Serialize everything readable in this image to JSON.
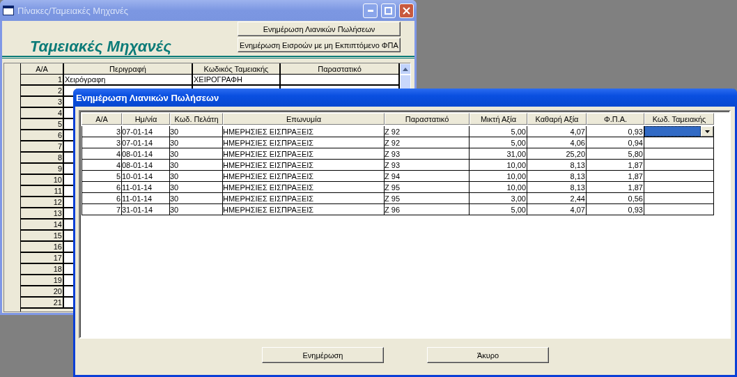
{
  "back_window": {
    "title": "Πίνακες/Ταμειακές Μηχανές",
    "buttons": [
      "Ενημέρωση Λιανικών Πωλήσεων",
      "Ενημέρωση Εισροών με μη Εκπιπτόμενο ΦΠΑ"
    ],
    "heading": "Ταμειακές Μηχανές",
    "table": {
      "columns": [
        "Α/Α",
        "Περιγραφή",
        "Κωδικός Ταμειακής",
        "Παραστατικό"
      ],
      "rows": [
        {
          "aa": "1",
          "description": "Χειρόγραφη",
          "code": "ΧΕΙΡΟΓΡΑΦΗ"
        },
        {
          "aa": "2"
        },
        {
          "aa": "3"
        },
        {
          "aa": "4"
        },
        {
          "aa": "5"
        },
        {
          "aa": "6"
        },
        {
          "aa": "7"
        },
        {
          "aa": "8"
        },
        {
          "aa": "9"
        },
        {
          "aa": "10"
        },
        {
          "aa": "11"
        },
        {
          "aa": "12"
        },
        {
          "aa": "13"
        },
        {
          "aa": "14"
        },
        {
          "aa": "15"
        },
        {
          "aa": "16"
        },
        {
          "aa": "17"
        },
        {
          "aa": "18"
        },
        {
          "aa": "19"
        },
        {
          "aa": "20"
        },
        {
          "aa": "21"
        }
      ]
    }
  },
  "dialog": {
    "title": "Ενημέρωση Λιανικών Πωλήσεων",
    "table": {
      "columns": [
        "Α/Α",
        "Ημ/νία",
        "Κωδ. Πελάτη",
        "Επωνυμία",
        "Παραστατικό",
        "Μικτή Αξία",
        "Καθαρή Αξία",
        "Φ.Π.Α.",
        "Κωδ. Ταμειακής"
      ],
      "rows": [
        {
          "cells": [
            "3",
            "07-01-14",
            "30",
            "ΗΜΕΡΗΣΙΕΣ ΕΙΣΠΡΑΞΕΙΣ",
            "Ζ 92",
            "5,00",
            "4,07",
            "0,93"
          ],
          "selected": true
        },
        {
          "cells": [
            "3",
            "07-01-14",
            "30",
            "ΗΜΕΡΗΣΙΕΣ ΕΙΣΠΡΑΞΕΙΣ",
            "Ζ 92",
            "5,00",
            "4,06",
            "0,94"
          ],
          "selected": false
        },
        {
          "cells": [
            "4",
            "08-01-14",
            "30",
            "ΗΜΕΡΗΣΙΕΣ ΕΙΣΠΡΑΞΕΙΣ",
            "Ζ 93",
            "31,00",
            "25,20",
            "5,80"
          ],
          "selected": false
        },
        {
          "cells": [
            "4",
            "08-01-14",
            "30",
            "ΗΜΕΡΗΣΙΕΣ ΕΙΣΠΡΑΞΕΙΣ",
            "Ζ 93",
            "10,00",
            "8,13",
            "1,87"
          ],
          "selected": false
        },
        {
          "cells": [
            "5",
            "10-01-14",
            "30",
            "ΗΜΕΡΗΣΙΕΣ ΕΙΣΠΡΑΞΕΙΣ",
            "Ζ 94",
            "10,00",
            "8,13",
            "1,87"
          ],
          "selected": false
        },
        {
          "cells": [
            "6",
            "11-01-14",
            "30",
            "ΗΜΕΡΗΣΙΕΣ ΕΙΣΠΡΑΞΕΙΣ",
            "Ζ 95",
            "10,00",
            "8,13",
            "1,87"
          ],
          "selected": false
        },
        {
          "cells": [
            "6",
            "11-01-14",
            "30",
            "ΗΜΕΡΗΣΙΕΣ ΕΙΣΠΡΑΞΕΙΣ",
            "Ζ 95",
            "3,00",
            "2,44",
            "0,56"
          ],
          "selected": false
        },
        {
          "cells": [
            "7",
            "31-01-14",
            "30",
            "ΗΜΕΡΗΣΙΕΣ ΕΙΣΠΡΑΞΕΙΣ",
            "Ζ 96",
            "5,00",
            "4,07",
            "0,93"
          ],
          "selected": false
        }
      ]
    },
    "buttons": [
      "Ενημέρωση",
      "Άκυρο"
    ]
  }
}
